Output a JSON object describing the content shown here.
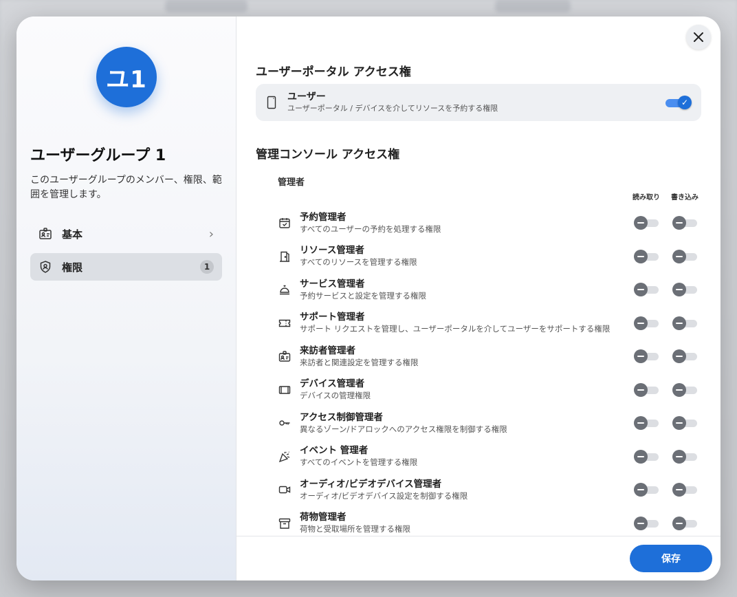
{
  "sidebar": {
    "avatar_text": "ユ1",
    "group_title": "ユーザーグループ 1",
    "group_description": "このユーザーグループのメンバー、権限、範囲を管理します。",
    "items": [
      {
        "label": "基本",
        "icon": "id-card-icon"
      },
      {
        "label": "権限",
        "icon": "shield-user-icon",
        "count": "1"
      }
    ]
  },
  "portal_section": {
    "title": "ユーザーポータル アクセス権",
    "item": {
      "title": "ユーザー",
      "description": "ユーザーポータル / デバイスを介してリソースを予約する権限",
      "enabled": true
    }
  },
  "console_section": {
    "title": "管理コンソール アクセス権",
    "group_label": "管理者",
    "col_read": "読み取り",
    "col_write": "書き込み",
    "roles": [
      {
        "title": "予約管理者",
        "description": "すべてのユーザーの予約を処理する権限",
        "icon": "calendar-check-icon"
      },
      {
        "title": "リソース管理者",
        "description": "すべてのリソースを管理する権限",
        "icon": "door-icon"
      },
      {
        "title": "サービス管理者",
        "description": "予約サービスと設定を管理する権限",
        "icon": "service-bell-icon"
      },
      {
        "title": "サポート管理者",
        "description": "サポート リクエストを管理し、ユーザーポータルを介してユーザーをサポートする権限",
        "icon": "ticket-icon"
      },
      {
        "title": "来訪者管理者",
        "description": "来訪者と関連設定を管理する権限",
        "icon": "visitor-badge-icon"
      },
      {
        "title": "デバイス管理者",
        "description": "デバイスの管理権限",
        "icon": "tablet-icon"
      },
      {
        "title": "アクセス制御管理者",
        "description": "異なるゾーン/ドアロックへのアクセス権限を制御する権限",
        "icon": "key-icon"
      },
      {
        "title": "イベント 管理者",
        "description": "すべてのイベントを管理する権限",
        "icon": "party-popper-icon"
      },
      {
        "title": "オーディオ/ビデオデバイス管理者",
        "description": "オーディオ/ビデオデバイス設定を制御する権限",
        "icon": "video-camera-icon"
      },
      {
        "title": "荷物管理者",
        "description": "荷物と受取場所を管理する権限",
        "icon": "archive-box-icon"
      }
    ]
  },
  "footer": {
    "save_label": "保存"
  },
  "colors": {
    "primary": "#1e6fd9",
    "toggle_off_knob": "#6b6f76",
    "selected_nav_bg": "#dcdfe4"
  }
}
